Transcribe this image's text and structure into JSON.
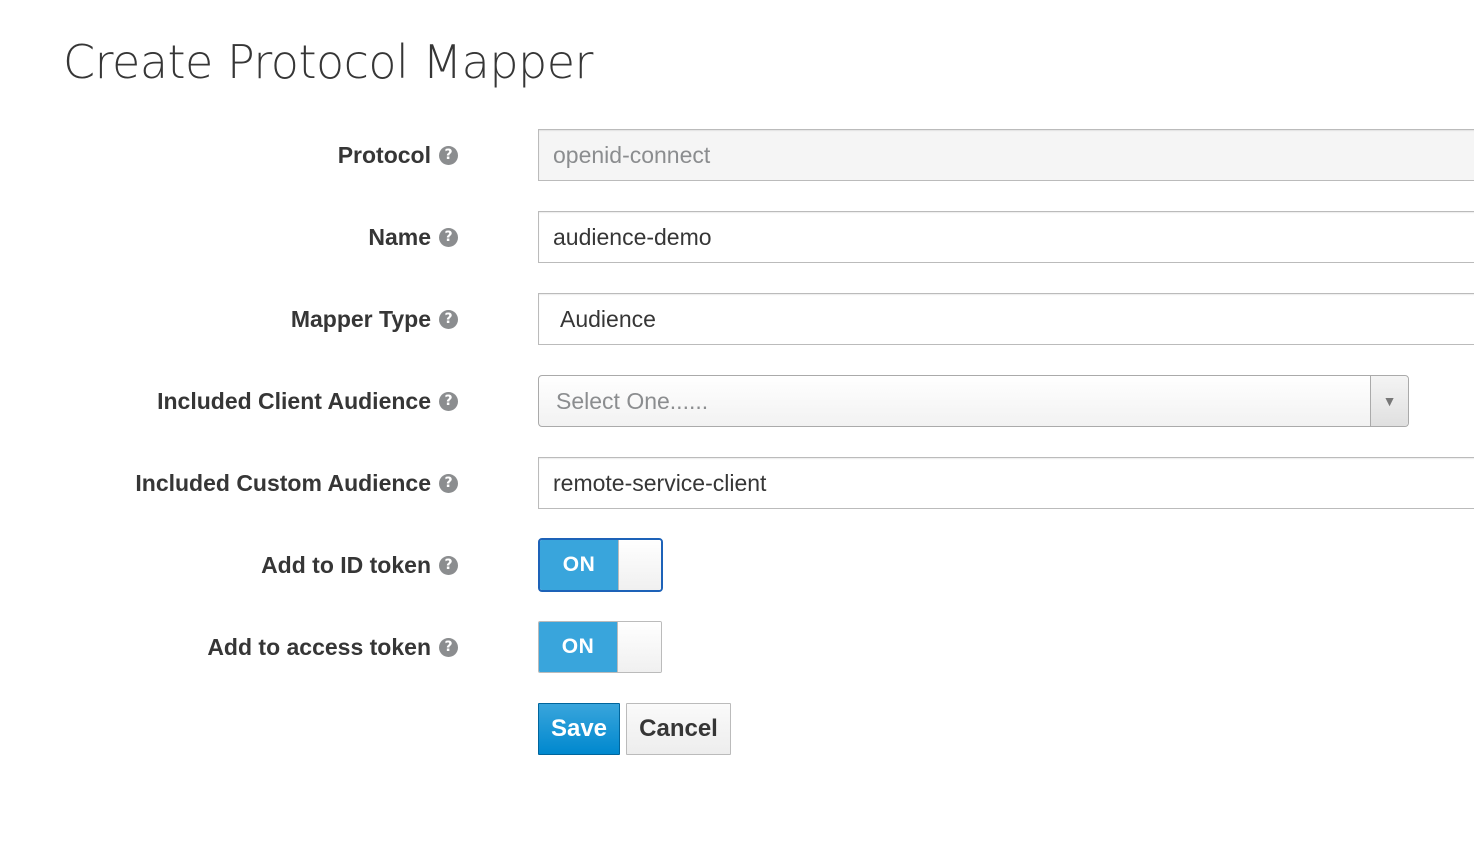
{
  "page": {
    "title": "Create Protocol Mapper"
  },
  "form": {
    "protocol": {
      "label": "Protocol",
      "value": "openid-connect"
    },
    "name": {
      "label": "Name",
      "value": "audience-demo"
    },
    "mapper_type": {
      "label": "Mapper Type",
      "value": "Audience"
    },
    "included_client_audience": {
      "label": "Included Client Audience",
      "placeholder": "Select One......"
    },
    "included_custom_audience": {
      "label": "Included Custom Audience",
      "value": "remote-service-client"
    },
    "add_to_id_token": {
      "label": "Add to ID token",
      "state_label": "ON",
      "on": true
    },
    "add_to_access_token": {
      "label": "Add to access token",
      "state_label": "ON",
      "on": true
    }
  },
  "icons": {
    "help": "question-circle-icon",
    "help_glyph": "?",
    "dropdown": "caret-down-icon",
    "dropdown_glyph": "▼"
  },
  "actions": {
    "save_label": "Save",
    "cancel_label": "Cancel"
  },
  "colors": {
    "primary": "#0088ce",
    "toggle_on": "#39a5dc",
    "focus_border": "#1d62b8",
    "text": "#363636",
    "muted": "#8b8d8f"
  }
}
